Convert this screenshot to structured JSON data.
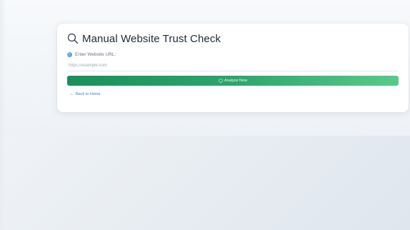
{
  "page": {
    "title": "Manual Website Trust Check"
  },
  "form": {
    "url_label": "Enter Website URL:",
    "url_placeholder": "https://example.com",
    "url_value": "",
    "analyze_label": "Analyze Now"
  },
  "nav": {
    "back_label": "Back to Home",
    "back_arrow": "←"
  },
  "icons": {
    "title_icon": "search-icon",
    "label_icon": "globe-icon",
    "button_icon": "shield-icon"
  },
  "colors": {
    "accent_green_start": "#1d8e5a",
    "accent_green_end": "#5ac98a",
    "link_blue": "#3b82c4",
    "globe_blue": "#2f86d6"
  }
}
